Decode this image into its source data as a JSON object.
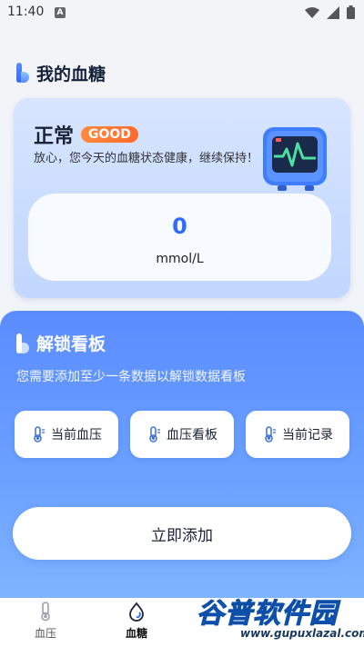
{
  "status_bar": {
    "time": "11:40",
    "notification_letter": "A"
  },
  "header": {
    "title": "我的血糖"
  },
  "status_card": {
    "state": "正常",
    "badge": "GOOD",
    "message": "放心，您今天的血糖状态健康，继续保持！",
    "reading": {
      "value": "0",
      "unit": "mmol/L"
    }
  },
  "unlock": {
    "title": "解锁看板",
    "description": "您需要添加至少一条数据以解锁数据看板",
    "actions": [
      {
        "label": "当前血压",
        "icon": "thermometer-icon"
      },
      {
        "label": "血压看板",
        "icon": "thermometer-icon"
      },
      {
        "label": "当前记录",
        "icon": "thermometer-icon"
      }
    ],
    "add_button": "立即添加"
  },
  "bottom_nav": {
    "items": [
      {
        "label": "血压",
        "icon": "thermometer-icon",
        "active": false
      },
      {
        "label": "血糖",
        "icon": "blood-drop-icon",
        "active": true
      }
    ]
  },
  "watermark": {
    "brand": "谷普软件园",
    "url": "www.gupuxlazal.com"
  },
  "colors": {
    "accent": "#2f6bff",
    "badge": "#ff7a35",
    "panel": "#5b8cff"
  }
}
